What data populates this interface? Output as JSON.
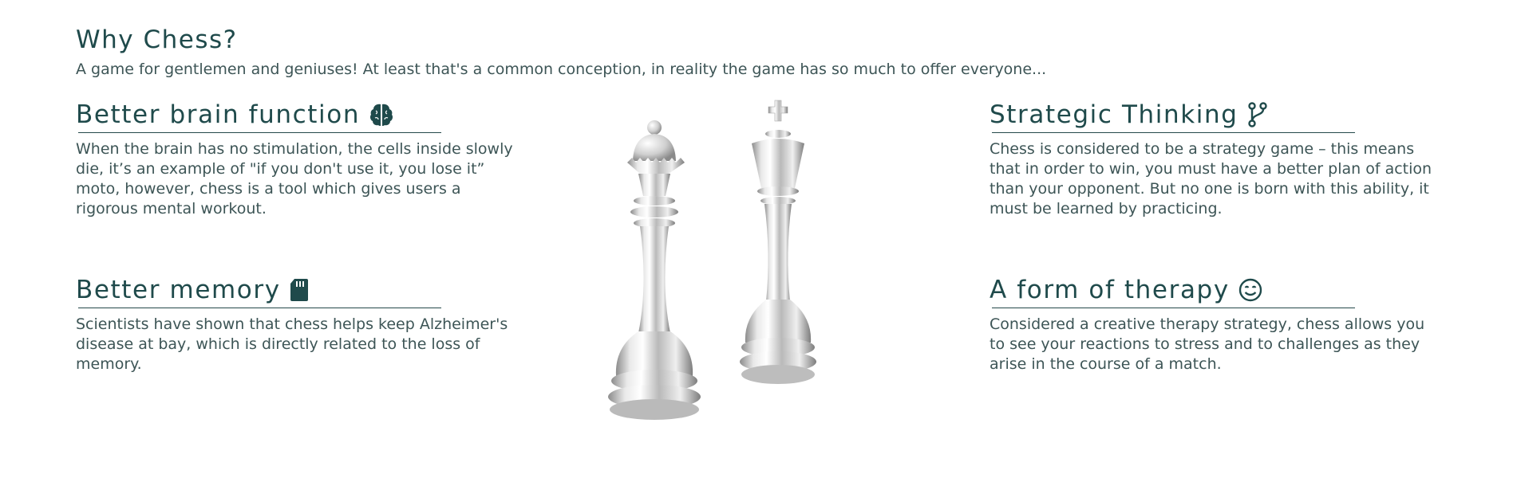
{
  "header": {
    "title": "Why Chess?",
    "subtitle": "A game for gentlemen and geniuses! At least that's a common conception, in reality the game has so much to offer everyone..."
  },
  "features": [
    {
      "heading": "Better brain function",
      "icon": "brain-icon",
      "text": "When the brain has no stimulation, the cells inside slowly die, it’s an example of \"if you don't use it, you lose it” moto, however, chess is a tool which gives users a rigorous mental workout."
    },
    {
      "heading": "Better memory",
      "icon": "sd-card-icon",
      "text": "Scientists have shown that chess helps keep Alzheimer's disease at bay, which is directly related to the loss of memory."
    },
    {
      "heading": "Strategic Thinking",
      "icon": "branch-icon",
      "text": "Chess is considered to be a strategy game – this means that in order to win, you must have a better plan of action than your opponent. But no one is born with this ability, it must be learned by practicing."
    },
    {
      "heading": "A form of therapy",
      "icon": "smile-icon",
      "text": "Considered a creative therapy strategy, chess allows you to see your reactions to stress and to challenges as they arise in the course of a match."
    }
  ],
  "colors": {
    "heading": "#1f4a4b",
    "body_text": "#3d5556",
    "rule": "#24494a",
    "icon": "#1f4a4b"
  }
}
